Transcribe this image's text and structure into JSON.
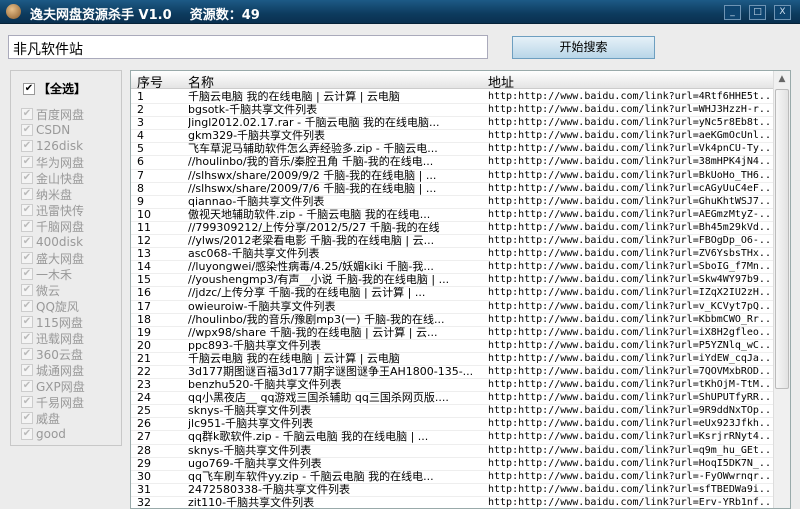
{
  "window": {
    "title": "逸夫网盘资源杀手 V1.0    资源数：49",
    "min": "_",
    "max": "□",
    "close": "X"
  },
  "search": {
    "value": "非凡软件站",
    "button": "开始搜索"
  },
  "sidebar": {
    "select_all": "【全选】",
    "items": [
      "百度网盘",
      "CSDN",
      "126disk",
      "华为网盘",
      "金山快盘",
      "纳米盘",
      "迅雷快传",
      "千脑网盘",
      "400disk",
      "盛大网盘",
      "一木禾",
      "微云",
      "QQ旋风",
      "115网盘",
      "迅载网盘",
      "360云盘",
      "城通网盘",
      "GXP网盘",
      "千易网盘",
      "威盘",
      "good"
    ]
  },
  "table": {
    "columns": [
      "序号",
      "名称",
      "地址"
    ],
    "rows": [
      [
        "1",
        "千脑云电脑 我的在线电脑 | 云计算 | 云电脑",
        "http:http://www.baidu.com/link?url=4Rtf6HHE5t.."
      ],
      [
        "2",
        "bgsotk-千脑共享文件列表",
        "http:http://www.baidu.com/link?url=WHJ3HzzH-r.."
      ],
      [
        "3",
        "Jingl2012.02.17.rar - 千脑云电脑 我的在线电脑...",
        "http:http://www.baidu.com/link?url=yNc5r8Eb8t.."
      ],
      [
        "4",
        "gkm329-千脑共享文件列表",
        "http:http://www.baidu.com/link?url=aeKGmOcUnl.."
      ],
      [
        "5",
        "飞车草泥马辅助软件怎么弄经验多.zip - 千脑云电...",
        "http:http://www.baidu.com/link?url=Vk4pnCU-Ty.."
      ],
      [
        "6",
        "//houlinbo/我的音乐/秦腔丑角 千脑-我的在线电...",
        "http:http://www.baidu.com/link?url=38mHPK4jN4.."
      ],
      [
        "7",
        "//slhswx/share/2009/9/2 千脑-我的在线电脑 | ...",
        "http:http://www.baidu.com/link?url=BkUoHo_TH6.."
      ],
      [
        "8",
        "//slhswx/share/2009/7/6 千脑-我的在线电脑 | ...",
        "http:http://www.baidu.com/link?url=cAGyUuC4eF.."
      ],
      [
        "9",
        "qiannao-千脑共享文件列表",
        "http:http://www.baidu.com/link?url=GhuKhtWSJ7.."
      ],
      [
        "10",
        "傲视天地辅助软件.zip - 千脑云电脑 我的在线电...",
        "http:http://www.baidu.com/link?url=AEGmzMtyZ-.."
      ],
      [
        "11",
        "//799309212/上传分享/2012/5/27 千脑-我的在线",
        "http:http://www.baidu.com/link?url=Bh45m29kVd.."
      ],
      [
        "12",
        "//ylws/2012老梁看电影 千脑-我的在线电脑 | 云...",
        "http:http://www.baidu.com/link?url=FBOgDp_O6-.."
      ],
      [
        "13",
        "asc068-千脑共享文件列表",
        "http:http://www.baidu.com/link?url=ZV6YsbsTHx.."
      ],
      [
        "14",
        "//luyongwei/感染性病毒/4.25/妖媚kiki 千脑-我...",
        "http:http://www.baidu.com/link?url=SboIG_f7Mn.."
      ],
      [
        "15",
        "//youshengmp3/有声__小说 千脑-我的在线电脑 | ...",
        "http:http://www.baidu.com/link?url=Skw4WY97b9.."
      ],
      [
        "16",
        "//jdzc/上传分享 千脑-我的在线电脑 | 云计算 | ...",
        "http:http://www.baidu.com/link?url=IZqX2IU2zH.."
      ],
      [
        "17",
        "owieuroiw-千脑共享文件列表",
        "http:http://www.baidu.com/link?url=v_KCVyt7pQ.."
      ],
      [
        "18",
        "//houlinbo/我的音乐/豫剧mp3(一) 千脑-我的在线...",
        "http:http://www.baidu.com/link?url=KbbmCWO_Rr.."
      ],
      [
        "19",
        "//wpx98/share 千脑-我的在线电脑 | 云计算 | 云...",
        "http:http://www.baidu.com/link?url=iX8H2gfleo.."
      ],
      [
        "20",
        "ppc893-千脑共享文件列表",
        "http:http://www.baidu.com/link?url=P5YZNlq_wC.."
      ],
      [
        "21",
        "千脑云电脑 我的在线电脑 | 云计算 | 云电脑",
        "http:http://www.baidu.com/link?url=iYdEW_cqJa.."
      ],
      [
        "22",
        "3d177期图谜百福3d177期字谜图谜争王AH1800-135-...",
        "http:http://www.baidu.com/link?url=7QOVMxbROD.."
      ],
      [
        "23",
        "benzhu520-千脑共享文件列表",
        "http:http://www.baidu.com/link?url=tKhOjM-TtM.."
      ],
      [
        "24",
        "qq小黑夜店__ qq游戏三国杀辅助 qq三国杀网页版....",
        "http:http://www.baidu.com/link?url=ShUPUTfyRR.."
      ],
      [
        "25",
        "sknys-千脑共享文件列表",
        "http:http://www.baidu.com/link?url=9R9ddNxTOp.."
      ],
      [
        "26",
        "jlc951-千脑共享文件列表",
        "http:http://www.baidu.com/link?url=eUx923Jfkh.."
      ],
      [
        "27",
        "qq群k歌软件.zip - 千脑云电脑 我的在线电脑 | ...",
        "http:http://www.baidu.com/link?url=KsrjrRNyt4.."
      ],
      [
        "28",
        "sknys-千脑共享文件列表",
        "http:http://www.baidu.com/link?url=q9m_hu_GEt.."
      ],
      [
        "29",
        "ugo769-千脑共享文件列表",
        "http:http://www.baidu.com/link?url=HoqI5DK7N_.."
      ],
      [
        "30",
        "qq飞车刷车软件yy.zip - 千脑云电脑 我的在线电...",
        "http:http://www.baidu.com/link?url=-FyOWwrnqr.."
      ],
      [
        "31",
        "2472580338-千脑共享文件列表",
        "http:http://www.baidu.com/link?url=sfTBEDWa9i.."
      ],
      [
        "32",
        "zit110-千脑共享文件列表",
        "http:http://www.baidu.com/link?url=Erv-YRb1nf.."
      ]
    ]
  }
}
